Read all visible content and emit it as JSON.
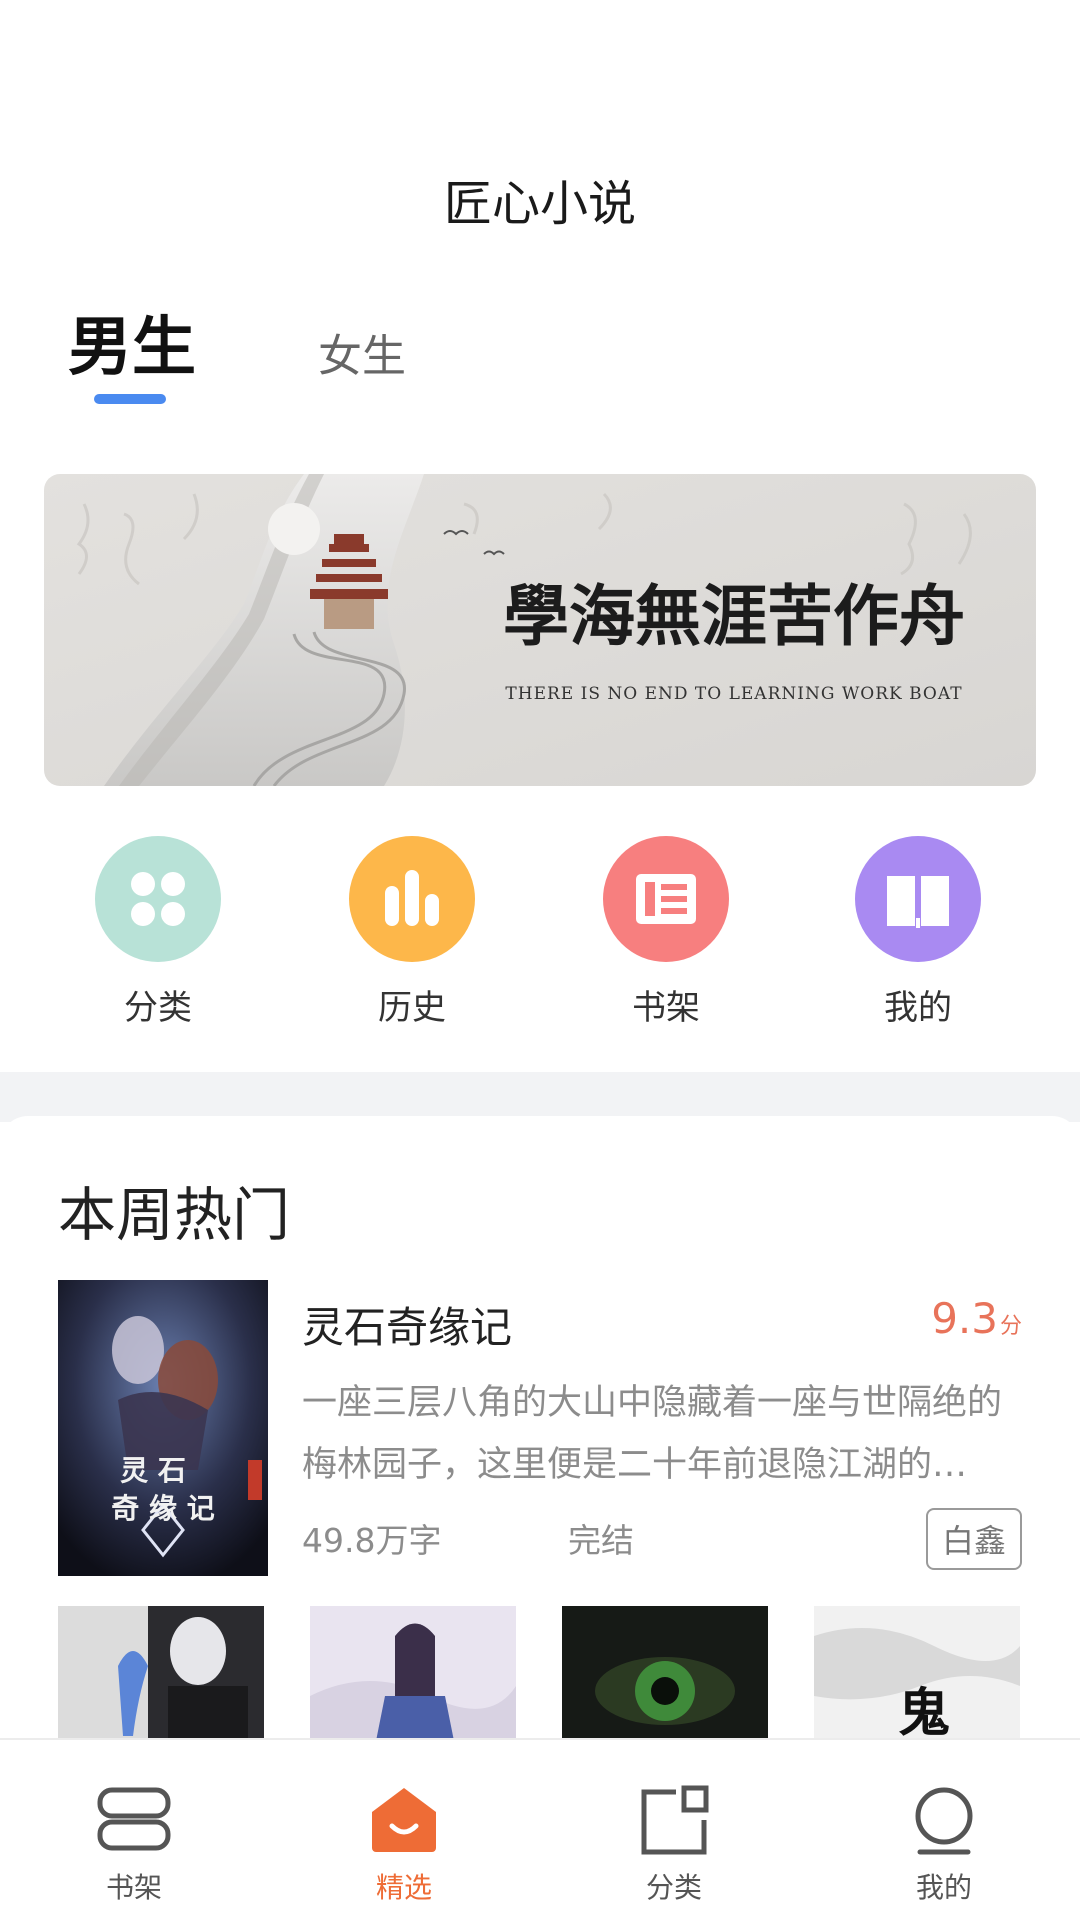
{
  "app": {
    "title": "匠心小说"
  },
  "tabs": {
    "male": "男生",
    "female": "女生"
  },
  "banner": {
    "calligraphy": "學海無涯苦作舟",
    "subtitle": "THERE IS NO END TO LEARNING WORK BOAT"
  },
  "quick_entries": [
    {
      "label": "分类",
      "icon": "grid-icon",
      "color": "#b7e3d6"
    },
    {
      "label": "历史",
      "icon": "bar-chart-icon",
      "color": "#fdb74a"
    },
    {
      "label": "书架",
      "icon": "bookshelf-icon",
      "color": "#f77f7f"
    },
    {
      "label": "我的",
      "icon": "open-book-icon",
      "color": "#a98af2"
    }
  ],
  "section": {
    "title": "本周热门"
  },
  "featured_book": {
    "title": "灵石奇缘记",
    "score": "9.3",
    "score_unit": "分",
    "description": "一座三层八角的大山中隐藏着一座与世隔绝的梅林园子，这里便是二十年前退隐江湖的…",
    "word_count": "49.8万字",
    "status": "完结",
    "author": "白鑫",
    "cover_text": "灵石奇缘记"
  },
  "thumbs": [
    {
      "icon": "cover-dark-hero"
    },
    {
      "icon": "cover-fantasy-warrior"
    },
    {
      "icon": "cover-green-eye"
    },
    {
      "icon": "cover-ink-ghost",
      "text": "鬼"
    }
  ],
  "bottom_nav": [
    {
      "label": "书架",
      "icon": "bookshelf-icon",
      "active": false
    },
    {
      "label": "精选",
      "icon": "home-icon",
      "active": true
    },
    {
      "label": "分类",
      "icon": "category-icon",
      "active": false
    },
    {
      "label": "我的",
      "icon": "profile-icon",
      "active": false
    }
  ],
  "colors": {
    "accent": "#ee6c36",
    "tab_indicator": "#4a8af0",
    "score": "#e8735a"
  }
}
